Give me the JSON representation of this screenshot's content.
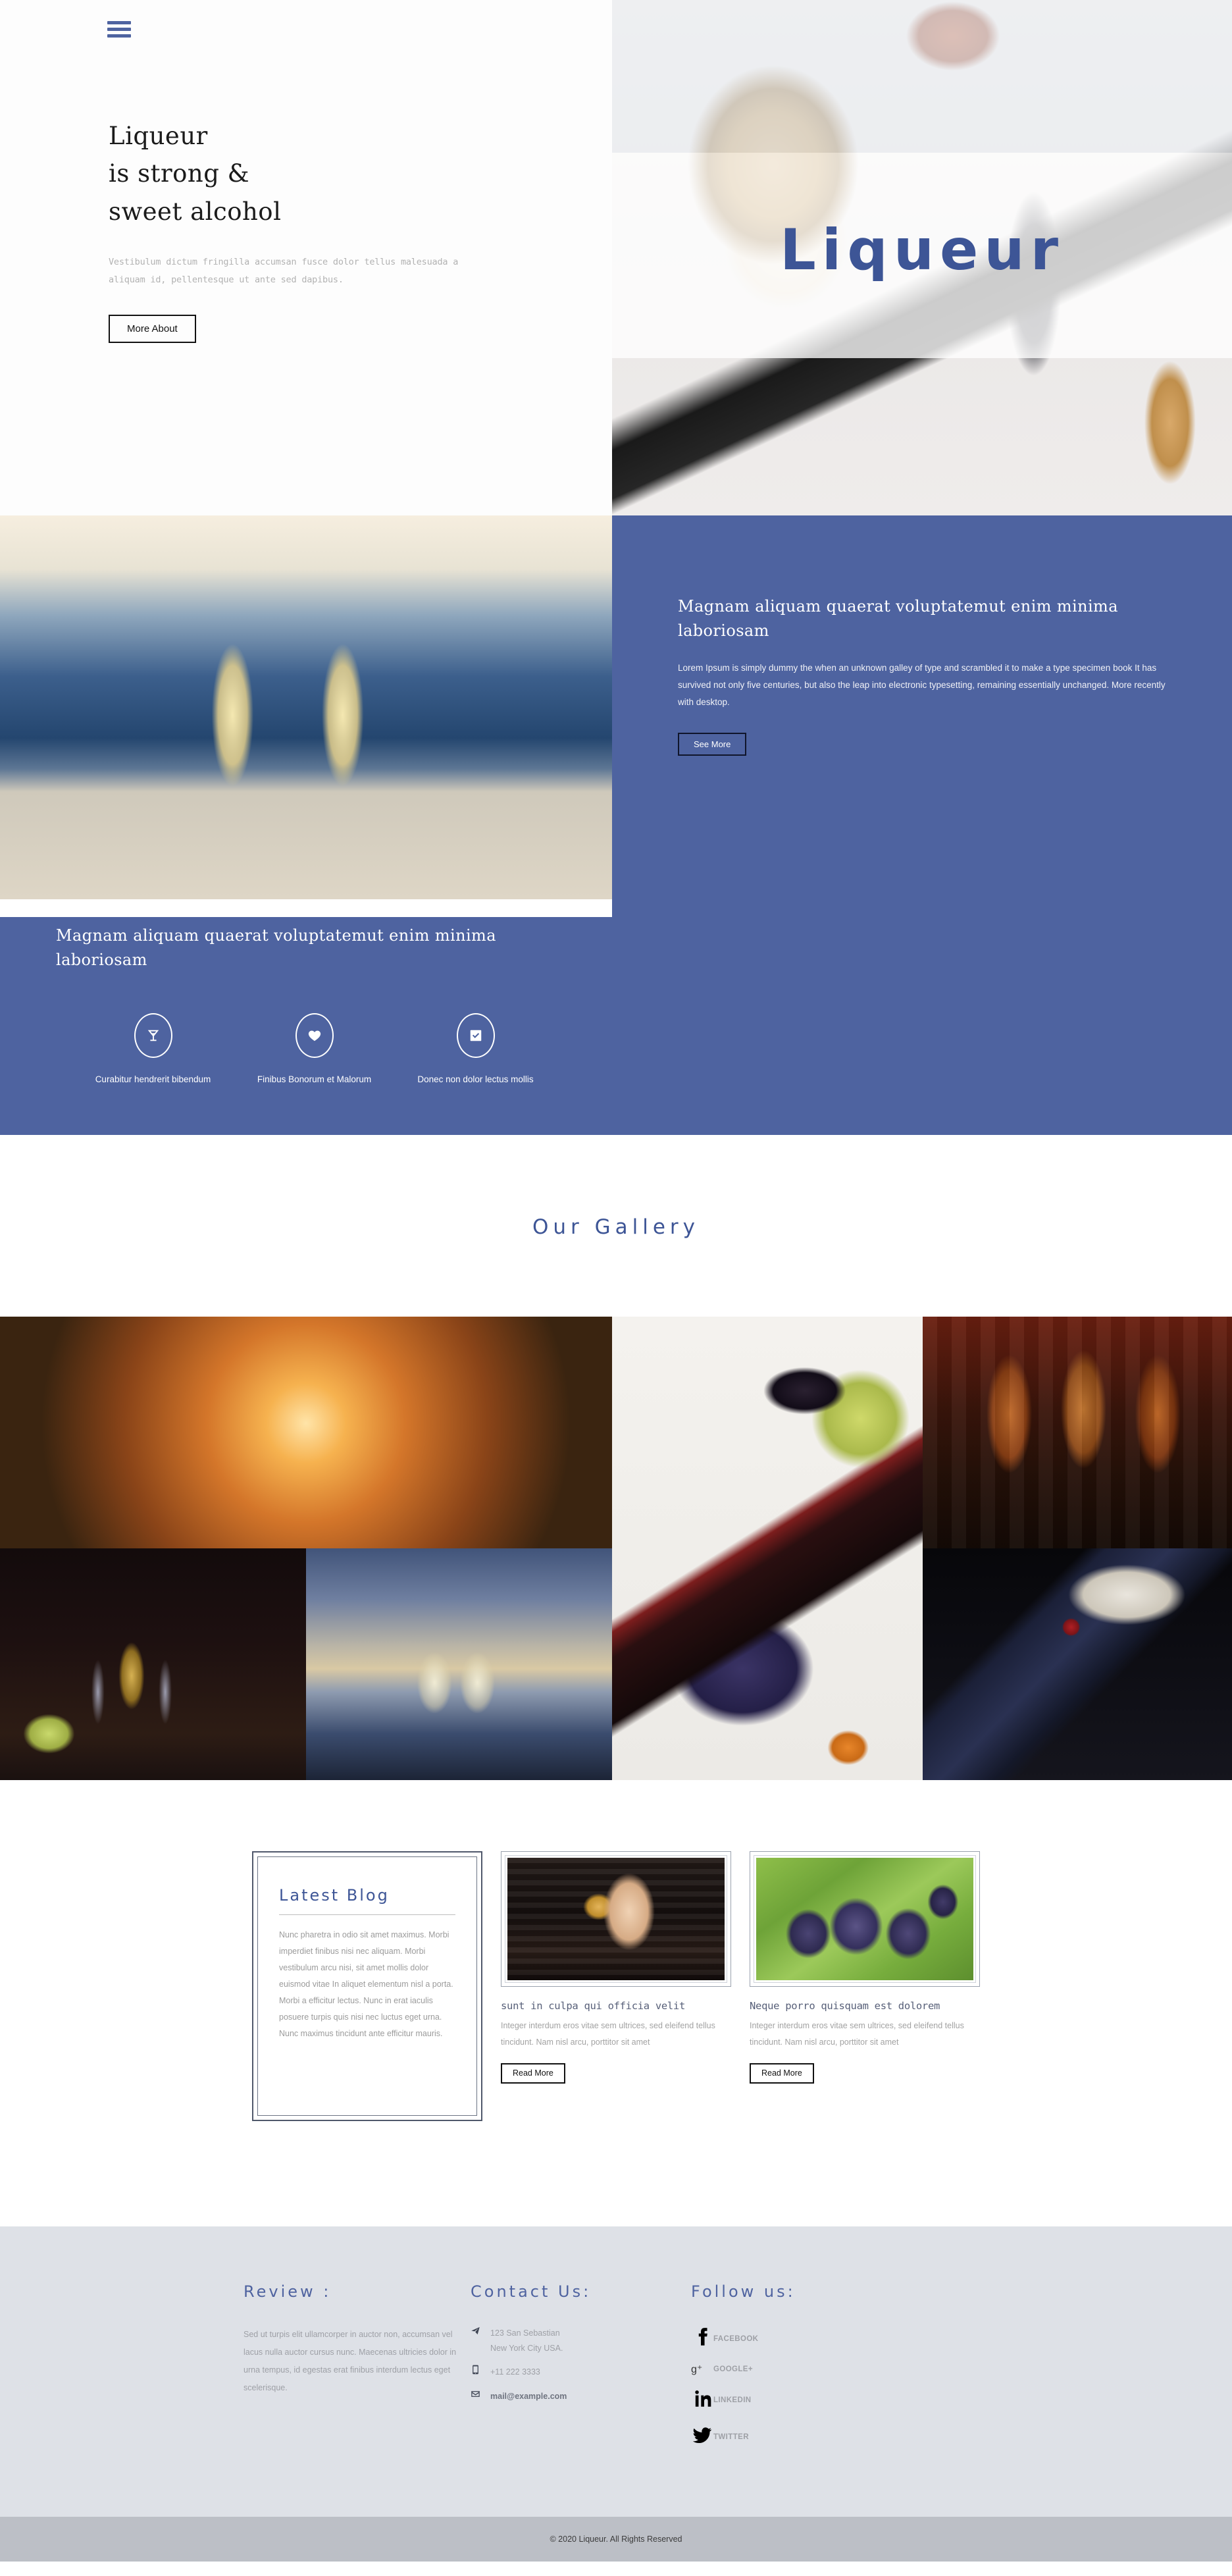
{
  "header": {
    "menu_icon": "hamburger-icon"
  },
  "hero": {
    "title_lines": [
      "Liqueur",
      "is strong &",
      "sweet alcohol"
    ],
    "title": "Liqueur\nis strong &\nsweet alcohol",
    "subtitle": "Vestibulum dictum fringilla accumsan fusce dolor tellus malesuada a aliquam id, pellentesque ut ante sed dapibus.",
    "cta_label": "More About",
    "overlay_title": "Liqueur",
    "overlay_color": "#3d5596"
  },
  "split": {
    "heading": "Magnam aliquam quaerat voluptatemut enim minima laboriosam",
    "paragraph": "Lorem Ipsum is simply dummy the when an unknown galley of type and scrambled it to make a type specimen book It has survived not only five centuries, but also the leap into electronic typesetting, remaining essentially unchanged. More recently with desktop.",
    "cta_label": "See More",
    "background_color": "#4e63a0"
  },
  "features": {
    "heading": "Magnam aliquam quaerat voluptatemut enim minima laboriosam",
    "items": [
      {
        "icon": "cocktail-glass-icon",
        "label": "Curabitur hendrerit bibendum"
      },
      {
        "icon": "heart-icon",
        "label": "Finibus Bonorum et Malorum"
      },
      {
        "icon": "check-square-icon",
        "label": "Donec non dolor lectus mollis"
      }
    ]
  },
  "gallery": {
    "title": "Our Gallery",
    "title_color": "#3d5596",
    "images": [
      {
        "name": "cheers-beer-bottles-sunset"
      },
      {
        "name": "wine-bottle-table-setting"
      },
      {
        "name": "whisky-bottles-bar-shelf"
      },
      {
        "name": "champagne-grapes-still-life"
      },
      {
        "name": "champagne-glasses-beach-sunset"
      },
      {
        "name": "moet-chandon-champagne-bottle"
      }
    ]
  },
  "blog": {
    "latest": {
      "title": "Latest Blog",
      "body": "Nunc pharetra in odio sit amet maximus. Morbi imperdiet finibus nisi nec aliquam. Morbi vestibulum arcu nisi, sit amet mollis dolor euismod vitae In aliquet elementum nisl a porta. Morbi a efficitur lectus. Nunc in erat iaculis posuere turpis quis nisi nec luctus eget urna. Nunc maximus tincidunt ante efficitur mauris."
    },
    "posts": [
      {
        "image": "woman-drinking-cocktail-at-bar",
        "title": "sunt in culpa qui officia velit",
        "excerpt": "Integer interdum eros vitae sem ultrices, sed eleifend tellus tincidunt. Nam nisl arcu, porttitor sit amet",
        "cta_label": "Read More"
      },
      {
        "image": "grapes-on-the-vine",
        "title": "Neque porro quisquam est dolorem",
        "excerpt": "Integer interdum eros vitae sem ultrices, sed eleifend tellus tincidunt. Nam nisl arcu, porttitor sit amet",
        "cta_label": "Read More"
      }
    ]
  },
  "footer": {
    "review": {
      "heading": "Review :",
      "text": "Sed ut turpis elit ullamcorper in auctor non, accumsan vel lacus nulla auctor cursus nunc. Maecenas ultricies dolor in urna tempus, id egestas erat finibus interdum lectus eget scelerisque."
    },
    "contact": {
      "heading": "Contact Us:",
      "address_line1": "123 San Sebastian",
      "address_line2": "New York City USA.",
      "phone": "+11 222 3333",
      "email": "mail@example.com"
    },
    "follow": {
      "heading": "Follow us:",
      "links": [
        {
          "icon": "facebook-icon",
          "label": "FACEBOOK"
        },
        {
          "icon": "google-plus-icon",
          "label": "GOOGLE+"
        },
        {
          "icon": "linkedin-icon",
          "label": "LINKEDIN"
        },
        {
          "icon": "twitter-icon",
          "label": "TWITTER"
        }
      ]
    },
    "copyright": "© 2020 Liqueur. All Rights Reserved",
    "background_color": "#dee1e7",
    "copyright_background": "#bcbfc6"
  }
}
